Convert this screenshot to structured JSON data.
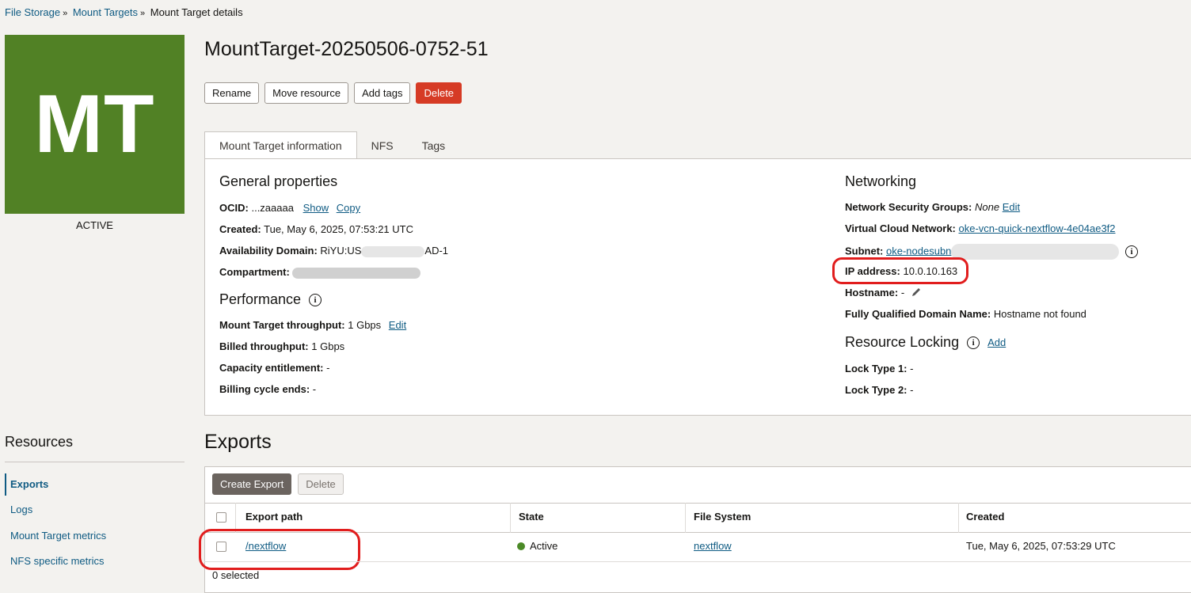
{
  "breadcrumb": {
    "item1": "File Storage",
    "item2": "Mount Targets",
    "item3": "Mount Target details",
    "sep": "»"
  },
  "badge": {
    "initials": "MT",
    "state": "ACTIVE",
    "color": "#518125"
  },
  "title": "MountTarget-20250506-0752-51",
  "actions": {
    "rename": "Rename",
    "move": "Move resource",
    "add_tags": "Add tags",
    "delete": "Delete"
  },
  "tabs": [
    {
      "label": "Mount Target information"
    },
    {
      "label": "NFS"
    },
    {
      "label": "Tags"
    }
  ],
  "general": {
    "title": "General properties",
    "ocid_label": "OCID:",
    "ocid_value": "...zaaaaa",
    "show": "Show",
    "copy": "Copy",
    "created_label": "Created:",
    "created_value": "Tue, May 6, 2025, 07:53:21 UTC",
    "ad_label": "Availability Domain:",
    "ad_prefix": "RiYU:US",
    "ad_suffix": "AD-1",
    "compartment_label": "Compartment:"
  },
  "performance": {
    "title": "Performance",
    "throughput_label": "Mount Target throughput:",
    "throughput_value": "1 Gbps",
    "edit": "Edit",
    "billed_label": "Billed throughput:",
    "billed_value": "1 Gbps",
    "capacity_label": "Capacity entitlement:",
    "capacity_value": "-",
    "billing_label": "Billing cycle ends:",
    "billing_value": "-"
  },
  "networking": {
    "title": "Networking",
    "nsg_label": "Network Security Groups:",
    "nsg_value": "None",
    "edit": "Edit",
    "vcn_label": "Virtual Cloud Network:",
    "vcn_value": "oke-vcn-quick-nextflow-4e04ae3f2",
    "subnet_label": "Subnet:",
    "subnet_value": "oke-nodesubn",
    "ip_label": "IP address:",
    "ip_value": "10.0.10.163",
    "hostname_label": "Hostname:",
    "hostname_value": "-",
    "fqdn_label": "Fully Qualified Domain Name:",
    "fqdn_value": "Hostname not found"
  },
  "locking": {
    "title": "Resource Locking",
    "add": "Add",
    "lock1_label": "Lock Type 1:",
    "lock1_value": "-",
    "lock2_label": "Lock Type 2:",
    "lock2_value": "-"
  },
  "resources": {
    "title": "Resources",
    "items": [
      {
        "label": "Exports"
      },
      {
        "label": "Logs"
      },
      {
        "label": "Mount Target metrics"
      },
      {
        "label": "NFS specific metrics"
      }
    ]
  },
  "exports": {
    "title": "Exports",
    "create": "Create Export",
    "delete": "Delete",
    "columns": {
      "path": "Export path",
      "state": "State",
      "fs": "File System",
      "created": "Created"
    },
    "rows": [
      {
        "path": "/nextflow",
        "state": "Active",
        "fs": "nextflow",
        "created": "Tue, May 6, 2025, 07:53:29 UTC"
      }
    ],
    "selected": "0 selected"
  },
  "colors": {
    "accent": "#0f5b83",
    "danger": "#d63b25",
    "annotation": "#e11d1d",
    "active_dot": "#4b8a27"
  },
  "icons": {
    "info": "info-icon",
    "edit": "pencil-icon"
  }
}
